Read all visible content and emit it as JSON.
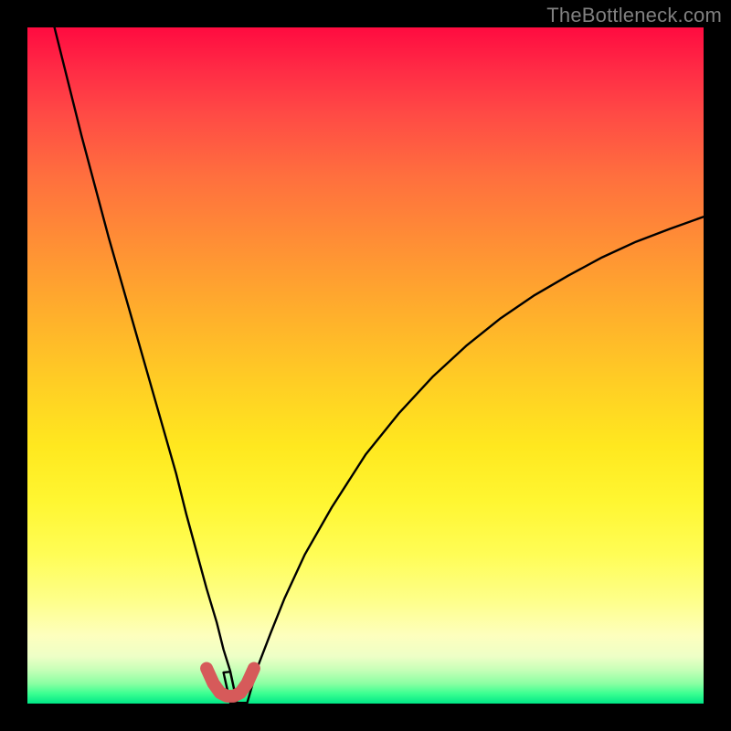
{
  "watermark": "TheBottleneck.com",
  "chart_data": {
    "type": "line",
    "title": "",
    "xlabel": "",
    "ylabel": "",
    "xlim": [
      0,
      100
    ],
    "ylim": [
      0,
      100
    ],
    "series": [
      {
        "name": "bottleneck-curve",
        "x": [
          4,
          6,
          8,
          10,
          12,
          14,
          16,
          18,
          20,
          22,
          23.5,
          25,
          26.5,
          28,
          29,
          30,
          31,
          30,
          29,
          30,
          31,
          32.5,
          34,
          36,
          38,
          41,
          45,
          50,
          55,
          60,
          65,
          70,
          75,
          80,
          85,
          90,
          95,
          100
        ],
        "values": [
          100,
          92,
          84,
          76.5,
          69,
          62,
          55,
          48,
          41,
          34,
          28,
          22.5,
          17,
          12,
          8,
          4.8,
          0.1,
          0.1,
          4.6,
          4.7,
          0.1,
          0.1,
          5.3,
          10.5,
          15.5,
          22,
          29,
          36.8,
          43,
          48.4,
          53,
          57,
          60.4,
          63.3,
          66,
          68.3,
          70.2,
          72
        ]
      },
      {
        "name": "trough-highlight",
        "x": [
          26.5,
          27.5,
          28.5,
          29.5,
          29.5,
          30.5,
          31.5,
          32.5,
          33.5
        ],
        "values": [
          5.2,
          3.0,
          1.6,
          1.1,
          1.1,
          1.1,
          1.6,
          3.0,
          5.2
        ]
      }
    ],
    "colors": {
      "curve": "#000000",
      "highlight": "#d65a5a"
    }
  }
}
